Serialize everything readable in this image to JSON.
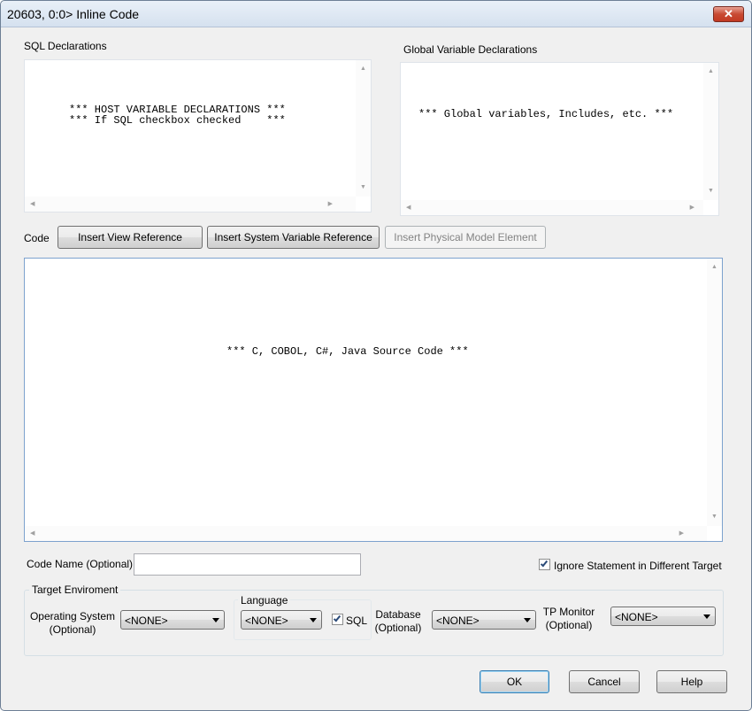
{
  "window": {
    "title": "20603, 0:0> Inline Code",
    "close_glyph": "✕"
  },
  "sql_declarations": {
    "label": "SQL Declarations",
    "lines": [
      "*** HOST VARIABLE DECLARATIONS ***",
      "*** If SQL checkbox checked    ***"
    ]
  },
  "global_variable_declarations": {
    "label": "Global Variable Declarations",
    "lines": [
      "*** Global variables, Includes, etc. ***"
    ]
  },
  "code": {
    "label": "Code",
    "text": "*** C, COBOL, C#, Java Source Code ***",
    "insert_view_reference": "Insert View Reference",
    "insert_system_variable_reference": "Insert System Variable Reference",
    "insert_physical_model_element": "Insert Physical Model Element"
  },
  "code_name": {
    "label": "Code Name (Optional)",
    "value": ""
  },
  "ignore_statement": {
    "label": "Ignore Statement in Different Target",
    "checked": true
  },
  "target_environment": {
    "title": "Target Enviroment",
    "operating_system": {
      "label_line1": "Operating System",
      "label_line2": "(Optional)",
      "value": "<NONE>"
    },
    "language": {
      "title": "Language",
      "value": "<NONE>",
      "sql_label": "SQL",
      "sql_checked": true
    },
    "database": {
      "label_line1": "Database",
      "label_line2": "(Optional)",
      "value": "<NONE>"
    },
    "tp_monitor": {
      "label_line1": "TP Monitor",
      "label_line2": "(Optional)",
      "value": "<NONE>"
    }
  },
  "footer": {
    "ok_label": "OK",
    "cancel_label": "Cancel",
    "help_label": "Help"
  },
  "icons": {
    "scroll_up": "▲",
    "scroll_down": "▼",
    "scroll_left": "◀",
    "scroll_right": "▶"
  }
}
